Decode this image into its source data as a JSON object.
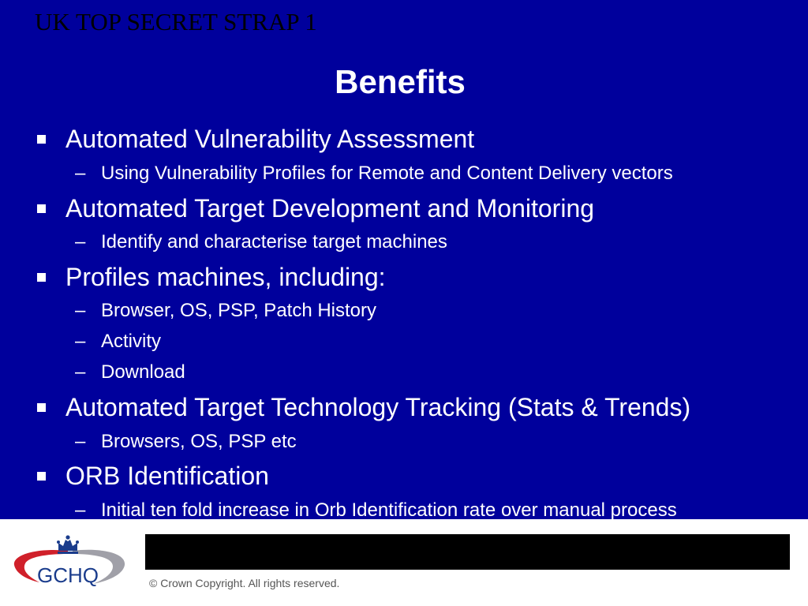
{
  "slide": {
    "classification": "UK TOP SECRET STRAP 1",
    "title": "Benefits",
    "items": [
      {
        "text": "Automated Vulnerability Assessment",
        "subitems": [
          "Using Vulnerability Profiles for Remote and Content Delivery vectors"
        ]
      },
      {
        "text": "Automated Target Development and Monitoring",
        "subitems": [
          "Identify and characterise target machines"
        ]
      },
      {
        "text": "Profiles machines, including:",
        "subitems": [
          "Browser, OS, PSP, Patch History",
          "Activity",
          "Download"
        ]
      },
      {
        "text": "Automated Target Technology Tracking (Stats & Trends)",
        "subitems": [
          "Browsers, OS, PSP etc"
        ]
      },
      {
        "text": "ORB Identification",
        "subitems": [
          "Initial ten fold increase in Orb Identification rate over manual process"
        ]
      }
    ]
  },
  "footer": {
    "logo_text": "GCHQ",
    "copyright": "© Crown Copyright. All rights reserved."
  },
  "colors": {
    "slide_background": "#00009c",
    "logo_red": "#d0202a",
    "logo_grey": "#a0a0a8",
    "logo_blue": "#1a3c8c"
  }
}
